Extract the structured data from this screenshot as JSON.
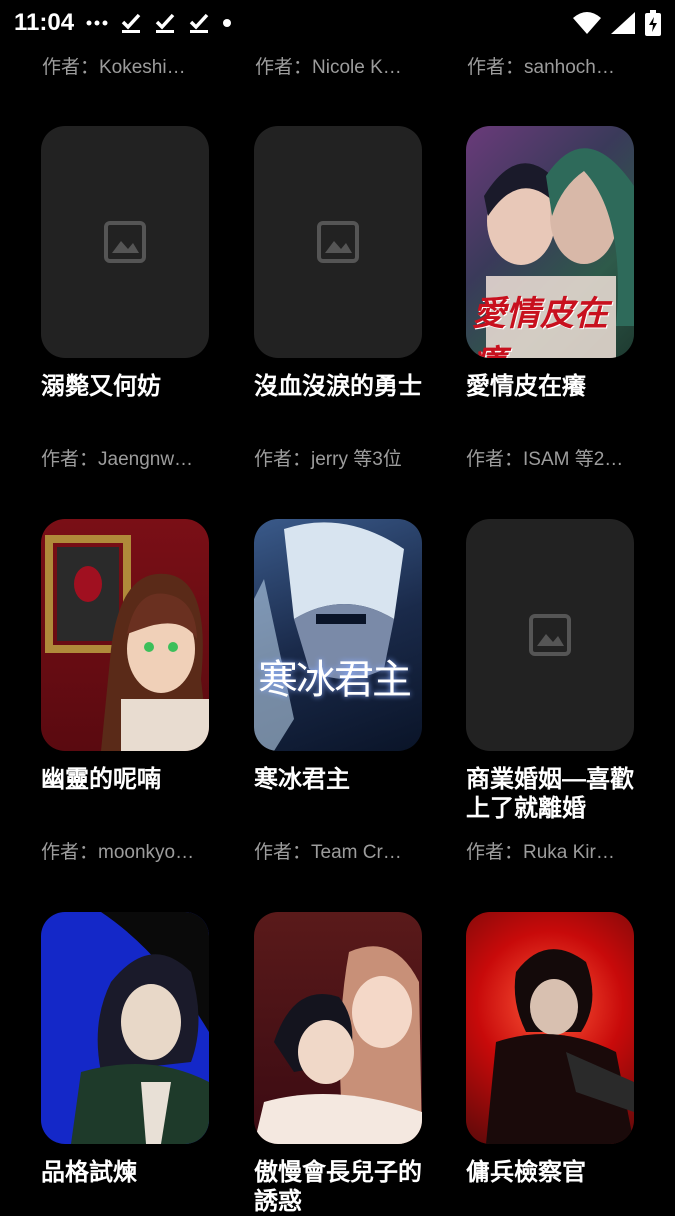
{
  "status_bar": {
    "time": "11:04",
    "icons": [
      "more-icon",
      "download-done-icon",
      "download-done-icon",
      "download-done-icon",
      "dot-icon",
      "wifi-icon",
      "signal-icon",
      "battery-charging-icon"
    ]
  },
  "top_row_authors": [
    "作者：Kokeshi…",
    "作者：Nicole K…",
    "作者：sanhoch…"
  ],
  "comics": [
    {
      "title": "溺斃又何妨",
      "author": "作者：Jaengnw…",
      "cover": "placeholder"
    },
    {
      "title": "沒血沒淚的勇士",
      "author": "作者：jerry 等3位",
      "cover": "placeholder"
    },
    {
      "title": "愛情皮在癢",
      "author": "作者：ISAM 等2…",
      "cover": "art",
      "cover_text": "愛情皮在癢",
      "cover_colors": [
        "#6a3a7a",
        "#2e5a4a",
        "#c42a3a"
      ]
    },
    {
      "title": "幽靈的呢喃",
      "author": "作者：moonkyo…",
      "cover": "art",
      "cover_colors": [
        "#7a0f16",
        "#3a1a12",
        "#e8dcd0"
      ]
    },
    {
      "title": "寒冰君主",
      "author": "作者：Team Cr…",
      "cover": "art",
      "cover_text": "寒冰君主",
      "cover_colors": [
        "#1a2a4a",
        "#9ab6d8",
        "#ffffff"
      ]
    },
    {
      "title": "商業婚姻—喜歡上了就離婚",
      "author": "作者：Ruka Kir…",
      "cover": "placeholder"
    },
    {
      "title": "品格試煉",
      "author": "",
      "cover": "art",
      "cover_colors": [
        "#1428c8",
        "#1e3a2a",
        "#e8e0d6"
      ]
    },
    {
      "title": "傲慢會長兒子的誘惑",
      "author": "",
      "cover": "art",
      "cover_colors": [
        "#3a0a12",
        "#d89a8a",
        "#f4d8c8"
      ]
    },
    {
      "title": "傭兵檢察官",
      "author": "",
      "cover": "art",
      "cover_colors": [
        "#c80a0a",
        "#1a0a0a",
        "#ff5a3a"
      ]
    }
  ]
}
